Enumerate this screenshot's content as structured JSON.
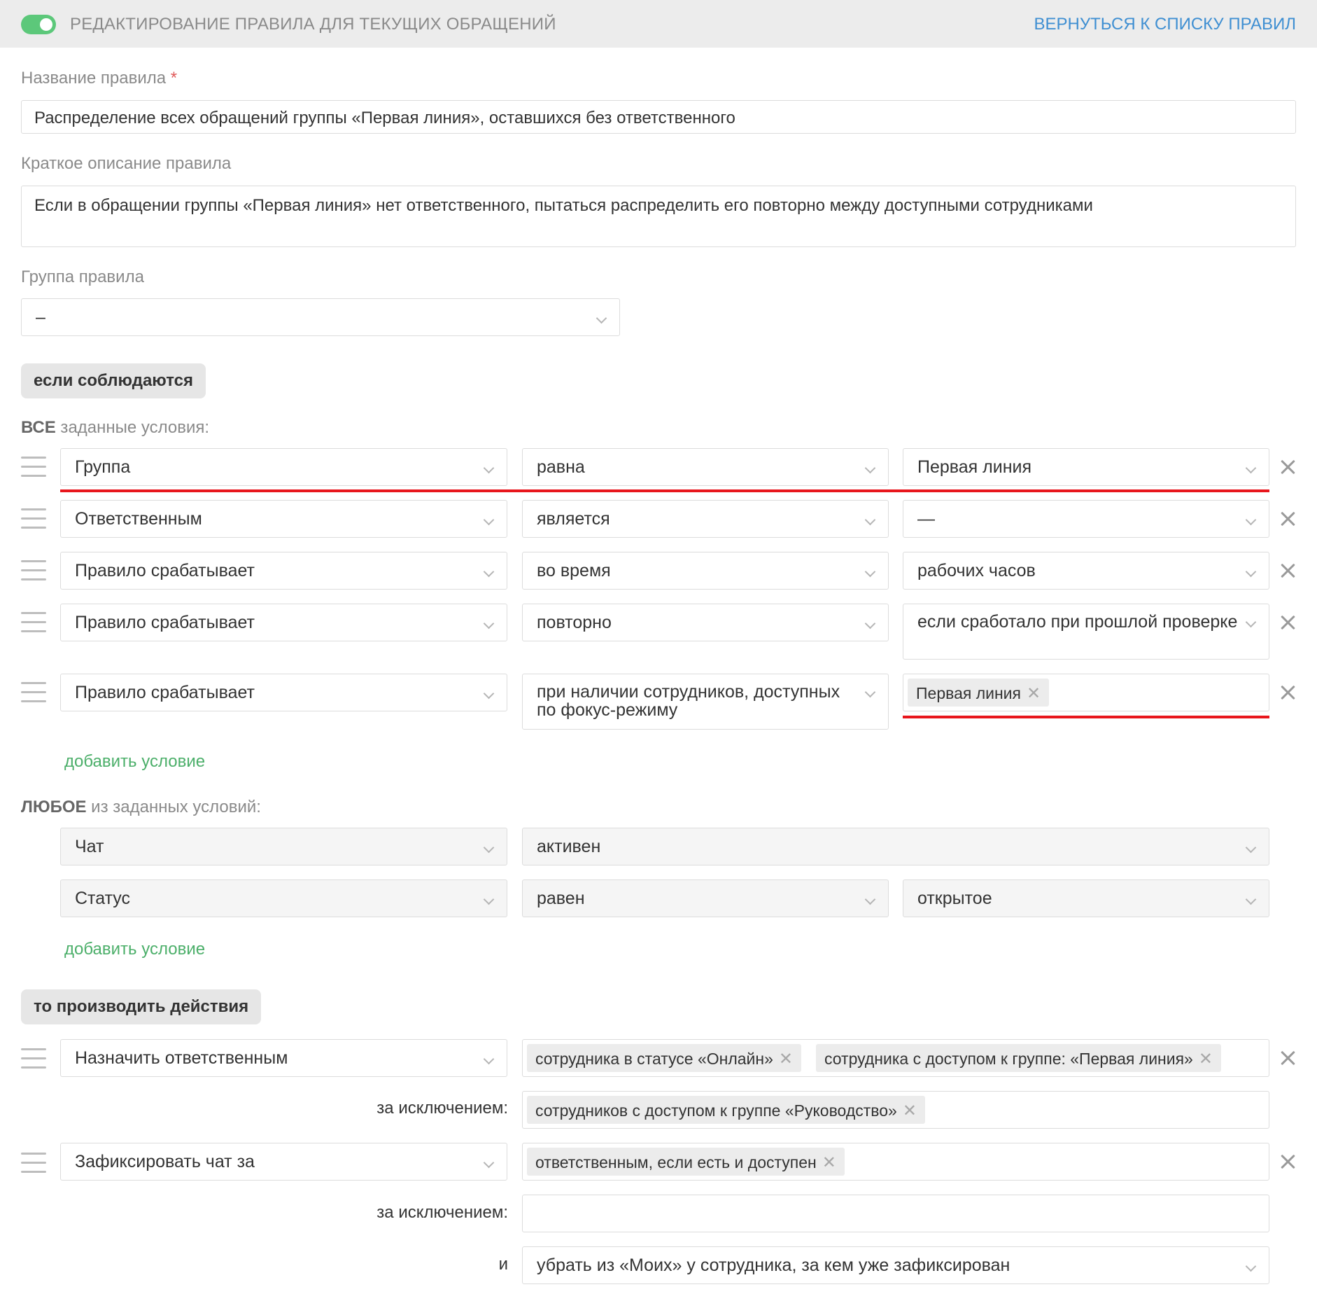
{
  "header": {
    "title": "РЕДАКТИРОВАНИЕ ПРАВИЛА ДЛЯ ТЕКУЩИХ ОБРАЩЕНИЙ",
    "back_link": "ВЕРНУТЬСЯ К СПИСКУ ПРАВИЛ",
    "toggle_on": true
  },
  "rule_name": {
    "label": "Название правила",
    "required_mark": "*",
    "value": "Распределение всех обращений группы «Первая линия», оставшихся без ответственного"
  },
  "description": {
    "label": "Краткое описание правила",
    "value": "Если в обращении группы «Первая линия» нет ответственного, пытаться распределить его повторно между доступными сотрудниками"
  },
  "group": {
    "label": "Группа правила",
    "value": "–"
  },
  "if_section": {
    "button": "если соблюдаются",
    "all_label_bold": "ВСЕ",
    "all_label_rest": " заданные условия:",
    "all_conditions": [
      {
        "field": "Группа",
        "operator": "равна",
        "value": "Первая линия"
      },
      {
        "field": "Ответственным",
        "operator": "является",
        "value": "—"
      },
      {
        "field": "Правило срабатывает",
        "operator": "во время",
        "value": "рабочих часов"
      },
      {
        "field": "Правило срабатывает",
        "operator": "повторно",
        "value": "если сработало при прошлой проверке"
      },
      {
        "field": "Правило срабатывает",
        "operator": "при наличии сотрудников, доступных по фокус-режиму",
        "tags": [
          "Первая линия"
        ]
      }
    ],
    "add_condition": "добавить условие",
    "any_label_bold": "ЛЮБОЕ",
    "any_label_rest": " из заданных условий:",
    "any_conditions": [
      {
        "field": "Чат",
        "operator": "активен"
      },
      {
        "field": "Статус",
        "operator": "равен",
        "value": "открытое"
      }
    ],
    "add_condition_2": "добавить условие"
  },
  "then_section": {
    "button": "то производить действия",
    "actions": [
      {
        "action": "Назначить ответственным",
        "tags": [
          "сотрудника в статусе «Онлайн»",
          "сотрудника с доступом к группе: «Первая линия»"
        ],
        "except_label": "за исключением:",
        "except_tags": [
          "сотрудников с доступом к группе «Руководство»"
        ]
      },
      {
        "action": "Зафиксировать чат за",
        "tags": [
          "ответственным, если есть и доступен"
        ],
        "except_label": "за исключением:",
        "and_label": "и",
        "and_value": "убрать из «Моих» у сотрудника, за кем уже зафиксирован"
      }
    ]
  },
  "colors": {
    "toggle": "#5cc87a",
    "link": "#3f8fd2",
    "add_link": "#4caf6a",
    "highlight": "#e8161c"
  },
  "tag_remove_glyph": "✕"
}
